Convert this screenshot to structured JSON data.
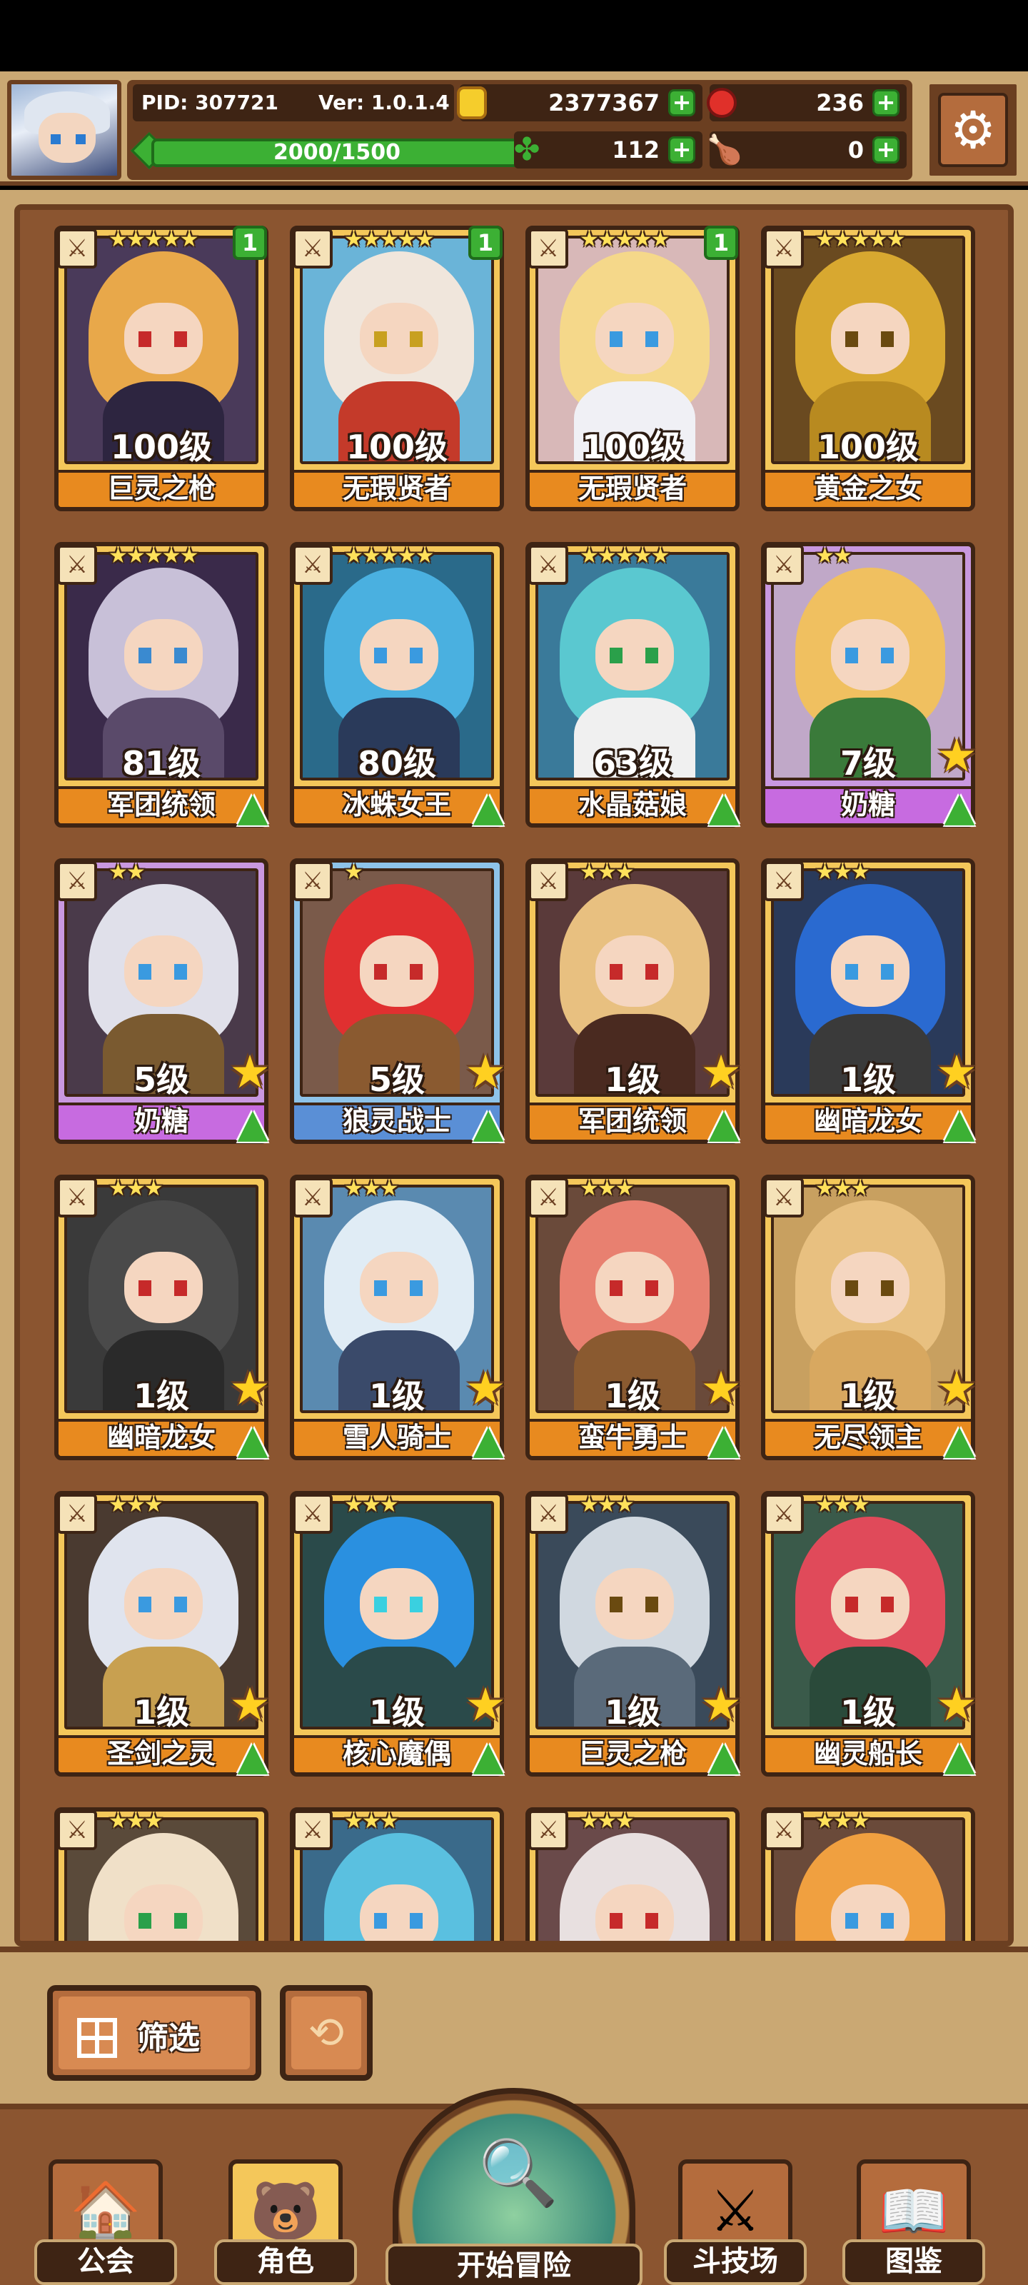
{
  "hud": {
    "pid": "PID: 307721",
    "version": "Ver: 1.0.1.4",
    "xp": "2000/1500",
    "gold": "2377367",
    "ruby": "236",
    "clover": "112",
    "meat": "0"
  },
  "colors": {
    "frame_brown": "#6b3f21",
    "panel_tan": "#caa873",
    "board_brown": "#8b5530",
    "name_orange": "#e88a1f",
    "name_purple": "#c76be0",
    "name_blue": "#5a8fd6",
    "plus_green": "#3cb034"
  },
  "cards": [
    {
      "name": "巨灵之枪",
      "level": "100级",
      "stars": "★★★★★",
      "count": "1",
      "rarity": "gold",
      "hair": "#e8a84a",
      "body": "#2d2540",
      "eye": "#c62a2a",
      "bg": "#4a3a5a",
      "upgrade": false,
      "bigstar": false
    },
    {
      "name": "无瑕贤者",
      "level": "100级",
      "stars": "★★★★★",
      "count": "1",
      "rarity": "gold",
      "hair": "#f0e6dc",
      "body": "#c43a2a",
      "eye": "#c8a020",
      "bg": "#6ab4d8",
      "upgrade": false,
      "bigstar": false
    },
    {
      "name": "无瑕贤者",
      "level": "100级",
      "stars": "★★★★★",
      "count": "1",
      "rarity": "gold",
      "hair": "#f5d88a",
      "body": "#f0f0f5",
      "eye": "#3a9ae0",
      "bg": "#d8b8b8",
      "upgrade": false,
      "bigstar": false
    },
    {
      "name": "黄金之女",
      "level": "100级",
      "stars": "★★★★★",
      "count": "",
      "rarity": "gold",
      "hair": "#d8a830",
      "body": "#b88a20",
      "eye": "#6a4a10",
      "bg": "#6a4a20",
      "upgrade": false,
      "bigstar": false
    },
    {
      "name": "军团统领",
      "level": "81级",
      "stars": "★★★★★",
      "count": "",
      "rarity": "gold",
      "hair": "#c8c0d8",
      "body": "#5a4a6a",
      "eye": "#3a8ad0",
      "bg": "#3a2a4a",
      "upgrade": true,
      "bigstar": false
    },
    {
      "name": "冰蛛女王",
      "level": "80级",
      "stars": "★★★★★",
      "count": "",
      "rarity": "gold",
      "hair": "#4ab0e0",
      "body": "#2a3a5a",
      "eye": "#3a9ae0",
      "bg": "#2a6a8a",
      "upgrade": true,
      "bigstar": false
    },
    {
      "name": "水晶菇娘",
      "level": "63级",
      "stars": "★★★★★",
      "count": "",
      "rarity": "gold",
      "hair": "#5ac8d0",
      "body": "#f0f0f0",
      "eye": "#2aa04a",
      "bg": "#3a7a9a",
      "upgrade": true,
      "bigstar": false
    },
    {
      "name": "奶糖",
      "level": "7级",
      "stars": "★★",
      "count": "",
      "rarity": "purple",
      "hair": "#f0c060",
      "body": "#3a7a3a",
      "eye": "#3a9ae0",
      "bg": "#c0a8c8",
      "upgrade": true,
      "bigstar": true
    },
    {
      "name": "奶糖",
      "level": "5级",
      "stars": "★★",
      "count": "",
      "rarity": "purple",
      "hair": "#e0e0ea",
      "body": "#7a5a30",
      "eye": "#3a9ae0",
      "bg": "#4a3a4a",
      "upgrade": true,
      "bigstar": true
    },
    {
      "name": "狼灵战士",
      "level": "5级",
      "stars": "★",
      "count": "",
      "rarity": "blue",
      "hair": "#e03030",
      "body": "#8a5a30",
      "eye": "#c62a2a",
      "bg": "#7a5a4a",
      "upgrade": true,
      "bigstar": true
    },
    {
      "name": "军团统领",
      "level": "1级",
      "stars": "★★★",
      "count": "",
      "rarity": "gold",
      "hair": "#e8c080",
      "body": "#4a2a20",
      "eye": "#c62a2a",
      "bg": "#5a3a3a",
      "upgrade": true,
      "bigstar": true
    },
    {
      "name": "幽暗龙女",
      "level": "1级",
      "stars": "★★★",
      "count": "",
      "rarity": "gold",
      "hair": "#2a6ad0",
      "body": "#3a3a3a",
      "eye": "#3a9ae0",
      "bg": "#2a3a5a",
      "upgrade": true,
      "bigstar": true
    },
    {
      "name": "幽暗龙女",
      "level": "1级",
      "stars": "★★★",
      "count": "",
      "rarity": "gold",
      "hair": "#4a4a4a",
      "body": "#2a2a2a",
      "eye": "#c62a2a",
      "bg": "#3a3a3a",
      "upgrade": true,
      "bigstar": true
    },
    {
      "name": "雪人骑士",
      "level": "1级",
      "stars": "★★★",
      "count": "",
      "rarity": "gold",
      "hair": "#e0ecf5",
      "body": "#3a4a6a",
      "eye": "#3a9ae0",
      "bg": "#5a8ab0",
      "upgrade": true,
      "bigstar": true
    },
    {
      "name": "蛮牛勇士",
      "level": "1级",
      "stars": "★★★",
      "count": "",
      "rarity": "gold",
      "hair": "#e88070",
      "body": "#8a5a30",
      "eye": "#c62a2a",
      "bg": "#6a4a3a",
      "upgrade": true,
      "bigstar": true
    },
    {
      "name": "无尽领主",
      "level": "1级",
      "stars": "★★★",
      "count": "",
      "rarity": "gold",
      "hair": "#e8c080",
      "body": "#d8a860",
      "eye": "#6a4a10",
      "bg": "#c8a060",
      "upgrade": true,
      "bigstar": true
    },
    {
      "name": "圣剑之灵",
      "level": "1级",
      "stars": "★★★",
      "count": "",
      "rarity": "gold",
      "hair": "#e0e4ee",
      "body": "#c8a050",
      "eye": "#3a9ae0",
      "bg": "#4a3a30",
      "upgrade": true,
      "bigstar": true
    },
    {
      "name": "核心魔偶",
      "level": "1级",
      "stars": "★★★",
      "count": "",
      "rarity": "gold",
      "hair": "#2a90e0",
      "body": "#2a4a4a",
      "eye": "#3ad0e0",
      "bg": "#2a4a4a",
      "upgrade": true,
      "bigstar": true
    },
    {
      "name": "巨灵之枪",
      "level": "1级",
      "stars": "★★★",
      "count": "",
      "rarity": "gold",
      "hair": "#d0d8e0",
      "body": "#5a6a7a",
      "eye": "#6a4a10",
      "bg": "#3a4a5a",
      "upgrade": true,
      "bigstar": true
    },
    {
      "name": "幽灵船长",
      "level": "1级",
      "stars": "★★★",
      "count": "",
      "rarity": "gold",
      "hair": "#e04a5a",
      "body": "#2a4a3a",
      "eye": "#c62a2a",
      "bg": "#3a5a4a",
      "upgrade": true,
      "bigstar": true
    },
    {
      "name": "",
      "level": "",
      "stars": "★★★",
      "count": "",
      "rarity": "gold",
      "hair": "#f0e0c8",
      "body": "#f0d8c0",
      "eye": "#2aa04a",
      "bg": "#5a4a3a",
      "upgrade": false,
      "bigstar": false
    },
    {
      "name": "",
      "level": "",
      "stars": "★★★",
      "count": "",
      "rarity": "gold",
      "hair": "#5ac0e0",
      "body": "#e8e8f0",
      "eye": "#3a9ae0",
      "bg": "#3a6a8a",
      "upgrade": false,
      "bigstar": false
    },
    {
      "name": "",
      "level": "",
      "stars": "★★★",
      "count": "",
      "rarity": "gold",
      "hair": "#e8e0e0",
      "body": "#d0c0c0",
      "eye": "#c62a2a",
      "bg": "#6a4a4a",
      "upgrade": false,
      "bigstar": false
    },
    {
      "name": "",
      "level": "",
      "stars": "★★★",
      "count": "",
      "rarity": "gold",
      "hair": "#f0a040",
      "body": "#e8b070",
      "eye": "#3a9ae0",
      "bg": "#6a4a3a",
      "upgrade": false,
      "bigstar": false
    }
  ],
  "filter": {
    "label": "筛选"
  },
  "nav": {
    "guild": "公会",
    "character": "角色",
    "adventure": "开始冒险",
    "arena": "斗技场",
    "codex": "图鉴"
  }
}
